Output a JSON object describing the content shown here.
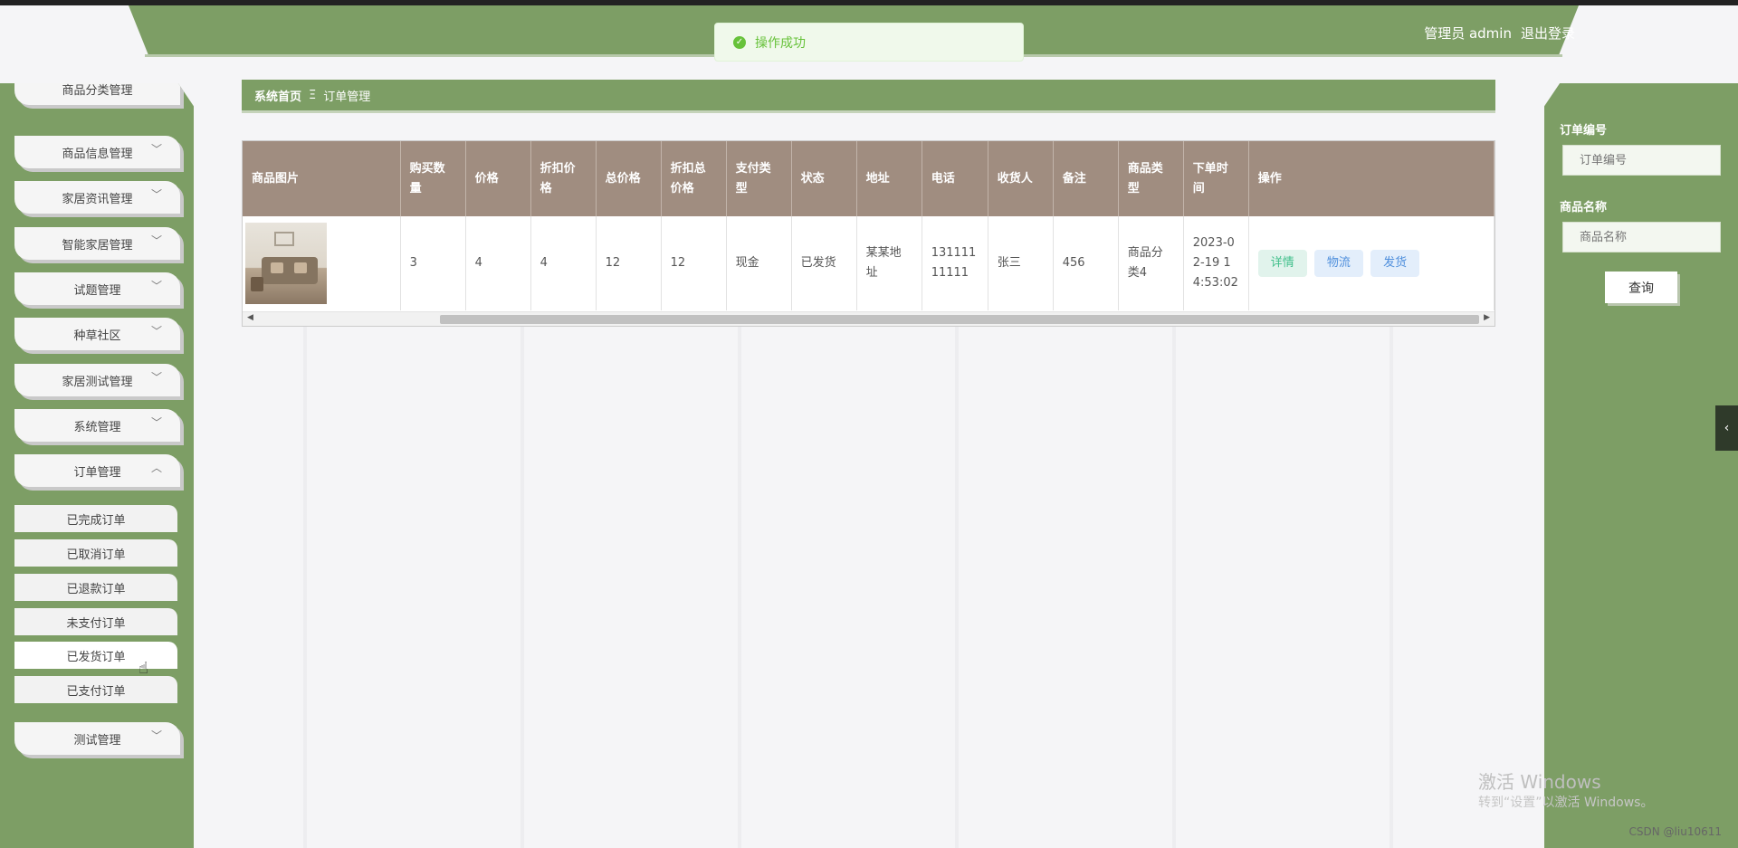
{
  "header": {
    "user_label": "管理员 admin",
    "logout_label": "退出登录"
  },
  "toast": {
    "message": "操作成功"
  },
  "sidebar": {
    "partial_top_item": "商品分类管理",
    "items": [
      {
        "label": "商品信息管理",
        "expanded": false
      },
      {
        "label": "家居资讯管理",
        "expanded": false
      },
      {
        "label": "智能家居管理",
        "expanded": false
      },
      {
        "label": "试题管理",
        "expanded": false
      },
      {
        "label": "种草社区",
        "expanded": false
      },
      {
        "label": "家居测试管理",
        "expanded": false
      },
      {
        "label": "系统管理",
        "expanded": false
      },
      {
        "label": "订单管理",
        "expanded": true
      }
    ],
    "sub_items": [
      "已完成订单",
      "已取消订单",
      "已退款订单",
      "未支付订单",
      "已发货订单",
      "已支付订单"
    ],
    "active_sub_index": 4,
    "last_item": {
      "label": "测试管理",
      "expanded": false
    }
  },
  "breadcrumb": {
    "home": "系统首页",
    "separator": "Ξ",
    "current": "订单管理"
  },
  "table": {
    "headers": [
      "商品图片",
      "购买数量",
      "价格",
      "折扣价格",
      "总价格",
      "折扣总价格",
      "支付类型",
      "状态",
      "地址",
      "电话",
      "收货人",
      "备注",
      "商品类型",
      "下单时间",
      "操作"
    ],
    "rows": [
      {
        "quantity": "3",
        "price": "4",
        "discount_price": "4",
        "total_price": "12",
        "discount_total": "12",
        "pay_type": "现金",
        "status": "已发货",
        "address": "某某地址",
        "phone": "13111111111",
        "receiver": "张三",
        "remark": "456",
        "category": "商品分类4",
        "order_time": "2023-02-19 14:53:02",
        "actions": [
          "详情",
          "物流",
          "发货"
        ]
      }
    ]
  },
  "search": {
    "order_no_label": "订单编号",
    "order_no_placeholder": "订单编号",
    "product_name_label": "商品名称",
    "product_name_placeholder": "商品名称",
    "query_button": "查询"
  },
  "watermark": {
    "line1": "激活 Windows",
    "line2": "转到“设置”以激活 Windows。"
  },
  "footer": {
    "credit": "CSDN @liu10611"
  },
  "colors": {
    "primary_green": "#7d9e65",
    "table_header": "#a08d80",
    "success": "#67c23a"
  }
}
